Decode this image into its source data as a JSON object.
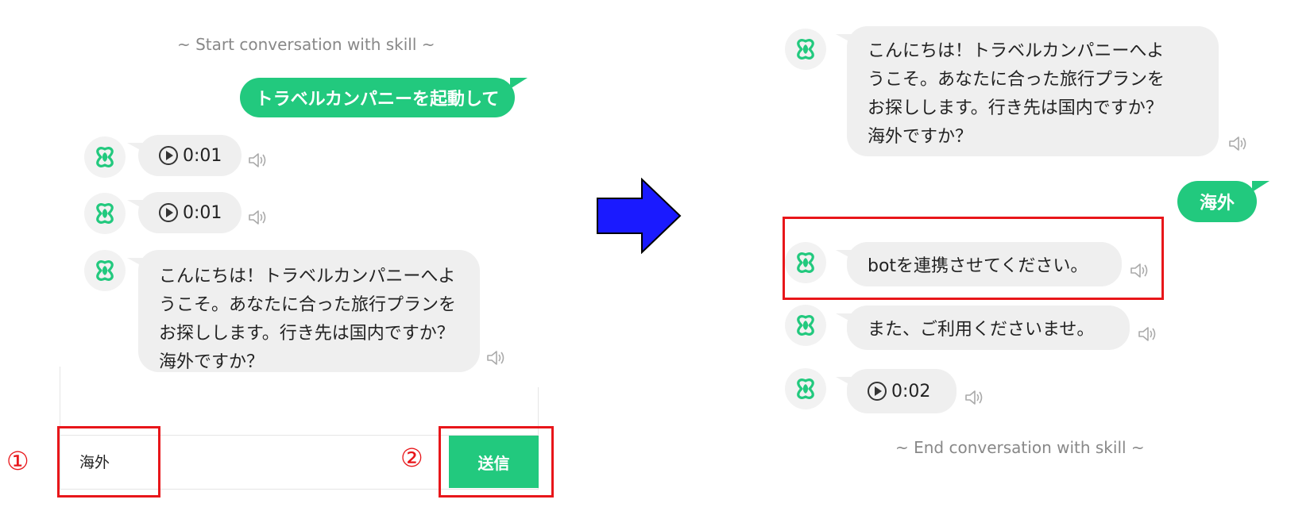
{
  "left": {
    "start_text": "~ Start conversation with skill ~",
    "user_message": "トラベルカンパニーを起動して",
    "audio_1": "0:01",
    "audio_2": "0:01",
    "bot_greeting": "こんにちは！トラベルカンパニーへよ\nうこそ。あなたに合った旅行プランを\nお探しします。行き先は国内ですか？\n海外ですか？",
    "input_value": "海外",
    "send_label": "送信",
    "step_1": "①",
    "step_2": "②"
  },
  "right": {
    "bot_greeting": "こんにちは！トラベルカンパニーへよ\nうこそ。あなたに合った旅行プランを\nお探しします。行き先は国内ですか？\n海外ですか？",
    "user_reply": "海外",
    "bot_link": "botを連携させてください。",
    "bot_thanks": "また、ご利用くださいませ。",
    "audio_3": "0:02",
    "end_text": "~ End conversation with skill ~"
  },
  "colors": {
    "accent": "#22c97e",
    "highlight": "#e8161a",
    "arrow": "#1a1aff",
    "bubble_bg": "#efefef"
  },
  "icons": [
    "clover-avatar-icon",
    "play-icon",
    "speaker-icon",
    "arrow-right-icon"
  ]
}
